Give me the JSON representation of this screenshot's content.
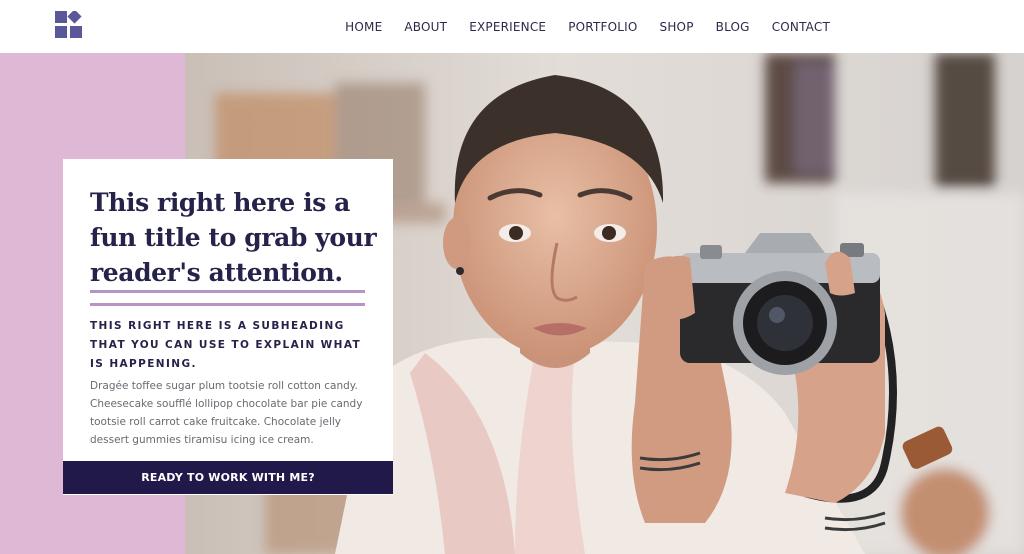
{
  "nav": {
    "items": [
      {
        "label": "HOME"
      },
      {
        "label": "ABOUT"
      },
      {
        "label": "EXPERIENCE"
      },
      {
        "label": "PORTFOLIO"
      },
      {
        "label": "SHOP"
      },
      {
        "label": "BLOG"
      },
      {
        "label": "CONTACT"
      }
    ]
  },
  "hero": {
    "title": "This right here is a fun title to grab your reader's attention.",
    "subheading": "THIS RIGHT HERE IS A SUBHEADING THAT YOU CAN USE TO EXPLAIN WHAT IS HAPPENING.",
    "body": "Dragée toffee sugar plum tootsie roll cotton candy. Cheesecake soufflé lollipop chocolate bar pie candy tootsie roll carrot cake fruitcake. Chocolate jelly dessert gummies tiramisu icing ice cream.",
    "cta_label": "READY TO WORK WITH ME?"
  },
  "colors": {
    "accent_pink": "#dfb8d6",
    "navy": "#20194a",
    "rule_purple": "#b793c6",
    "logo_purple": "#5b5899"
  },
  "icons": {
    "logo": "logo-squares-diamond-icon",
    "hero_image": "woman-with-camera-photo"
  }
}
